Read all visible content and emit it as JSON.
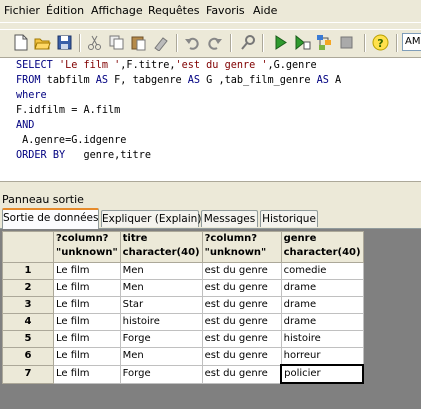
{
  "menu": [
    "Fichier",
    "Édition",
    "Affichage",
    "Requêtes",
    "Favoris",
    "Aide"
  ],
  "toolbar": {
    "icons": [
      "new-file-icon",
      "open-folder-icon",
      "save-icon",
      "cut-icon",
      "copy-icon",
      "paste-icon",
      "clear-icon",
      "undo-icon",
      "redo-icon",
      "find-icon",
      "execute-icon",
      "execute-to-file-icon",
      "explain-icon",
      "stop-icon",
      "help-icon"
    ],
    "dropdown_value": "AM"
  },
  "editor": {
    "lines": [
      "SELECT 'Le film ',F.titre,'est du genre ',G.genre",
      "FROM tabfilm AS F, tabgenre AS G ,tab_film_genre AS A",
      "where",
      "F.idfilm = A.film",
      "AND",
      " A.genre=G.idgenre",
      "ORDER BY   genre,titre"
    ]
  },
  "output_panel": {
    "title": "Panneau sortie",
    "tabs": [
      "Sortie de données",
      "Expliquer (Explain)",
      "Messages",
      "Historique"
    ],
    "active_tab": 0
  },
  "results": {
    "columns": [
      {
        "name": "?column?",
        "type": "\"unknown\""
      },
      {
        "name": "titre",
        "type": "character(40)"
      },
      {
        "name": "?column?",
        "type": "\"unknown\""
      },
      {
        "name": "genre",
        "type": "character(40)"
      }
    ],
    "rows": [
      {
        "num": "1",
        "cells": [
          "Le film",
          "Men",
          "est du genre",
          "comedie"
        ]
      },
      {
        "num": "2",
        "cells": [
          "Le film",
          "Men",
          "est du genre",
          "drame"
        ]
      },
      {
        "num": "3",
        "cells": [
          "Le film",
          "Star",
          "est du genre",
          "drame"
        ]
      },
      {
        "num": "4",
        "cells": [
          "Le film",
          "histoire",
          "est du genre",
          "drame"
        ]
      },
      {
        "num": "5",
        "cells": [
          "Le film",
          "Forge",
          "est du genre",
          "histoire"
        ]
      },
      {
        "num": "6",
        "cells": [
          "Le film",
          "Men",
          "est du genre",
          "horreur"
        ]
      },
      {
        "num": "7",
        "cells": [
          "Le film",
          "Forge",
          "est du genre",
          "policier"
        ]
      }
    ],
    "selected_row": 7,
    "selected_col": 4
  }
}
